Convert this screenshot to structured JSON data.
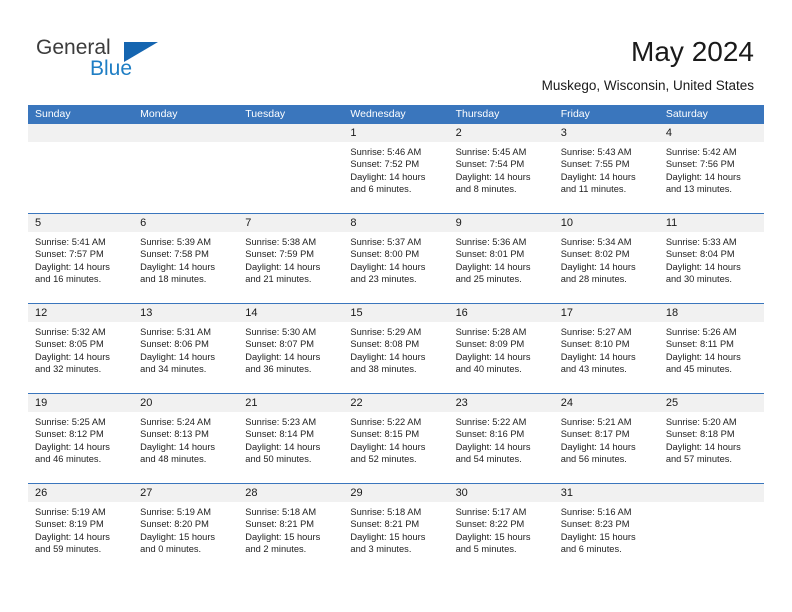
{
  "brand": {
    "name_part1": "General",
    "name_part2": "Blue",
    "triangle_icon": "triangle-icon",
    "accent_color": "#1565b0",
    "blue_text_color": "#1f7ec4"
  },
  "header": {
    "title": "May 2024",
    "location": "Muskego, Wisconsin, United States"
  },
  "calendar": {
    "header_bg": "#3a76bd",
    "day_band_bg": "#f1f1f1",
    "weekdays": [
      "Sunday",
      "Monday",
      "Tuesday",
      "Wednesday",
      "Thursday",
      "Friday",
      "Saturday"
    ],
    "labels": {
      "sunrise": "Sunrise:",
      "sunset": "Sunset:",
      "daylight": "Daylight:"
    },
    "weeks": [
      [
        {
          "day": "",
          "empty": true
        },
        {
          "day": "",
          "empty": true
        },
        {
          "day": "",
          "empty": true
        },
        {
          "day": "1",
          "sunrise": "Sunrise: 5:46 AM",
          "sunset": "Sunset: 7:52 PM",
          "daylight": "Daylight: 14 hours and 6 minutes."
        },
        {
          "day": "2",
          "sunrise": "Sunrise: 5:45 AM",
          "sunset": "Sunset: 7:54 PM",
          "daylight": "Daylight: 14 hours and 8 minutes."
        },
        {
          "day": "3",
          "sunrise": "Sunrise: 5:43 AM",
          "sunset": "Sunset: 7:55 PM",
          "daylight": "Daylight: 14 hours and 11 minutes."
        },
        {
          "day": "4",
          "sunrise": "Sunrise: 5:42 AM",
          "sunset": "Sunset: 7:56 PM",
          "daylight": "Daylight: 14 hours and 13 minutes."
        }
      ],
      [
        {
          "day": "5",
          "sunrise": "Sunrise: 5:41 AM",
          "sunset": "Sunset: 7:57 PM",
          "daylight": "Daylight: 14 hours and 16 minutes."
        },
        {
          "day": "6",
          "sunrise": "Sunrise: 5:39 AM",
          "sunset": "Sunset: 7:58 PM",
          "daylight": "Daylight: 14 hours and 18 minutes."
        },
        {
          "day": "7",
          "sunrise": "Sunrise: 5:38 AM",
          "sunset": "Sunset: 7:59 PM",
          "daylight": "Daylight: 14 hours and 21 minutes."
        },
        {
          "day": "8",
          "sunrise": "Sunrise: 5:37 AM",
          "sunset": "Sunset: 8:00 PM",
          "daylight": "Daylight: 14 hours and 23 minutes."
        },
        {
          "day": "9",
          "sunrise": "Sunrise: 5:36 AM",
          "sunset": "Sunset: 8:01 PM",
          "daylight": "Daylight: 14 hours and 25 minutes."
        },
        {
          "day": "10",
          "sunrise": "Sunrise: 5:34 AM",
          "sunset": "Sunset: 8:02 PM",
          "daylight": "Daylight: 14 hours and 28 minutes."
        },
        {
          "day": "11",
          "sunrise": "Sunrise: 5:33 AM",
          "sunset": "Sunset: 8:04 PM",
          "daylight": "Daylight: 14 hours and 30 minutes."
        }
      ],
      [
        {
          "day": "12",
          "sunrise": "Sunrise: 5:32 AM",
          "sunset": "Sunset: 8:05 PM",
          "daylight": "Daylight: 14 hours and 32 minutes."
        },
        {
          "day": "13",
          "sunrise": "Sunrise: 5:31 AM",
          "sunset": "Sunset: 8:06 PM",
          "daylight": "Daylight: 14 hours and 34 minutes."
        },
        {
          "day": "14",
          "sunrise": "Sunrise: 5:30 AM",
          "sunset": "Sunset: 8:07 PM",
          "daylight": "Daylight: 14 hours and 36 minutes."
        },
        {
          "day": "15",
          "sunrise": "Sunrise: 5:29 AM",
          "sunset": "Sunset: 8:08 PM",
          "daylight": "Daylight: 14 hours and 38 minutes."
        },
        {
          "day": "16",
          "sunrise": "Sunrise: 5:28 AM",
          "sunset": "Sunset: 8:09 PM",
          "daylight": "Daylight: 14 hours and 40 minutes."
        },
        {
          "day": "17",
          "sunrise": "Sunrise: 5:27 AM",
          "sunset": "Sunset: 8:10 PM",
          "daylight": "Daylight: 14 hours and 43 minutes."
        },
        {
          "day": "18",
          "sunrise": "Sunrise: 5:26 AM",
          "sunset": "Sunset: 8:11 PM",
          "daylight": "Daylight: 14 hours and 45 minutes."
        }
      ],
      [
        {
          "day": "19",
          "sunrise": "Sunrise: 5:25 AM",
          "sunset": "Sunset: 8:12 PM",
          "daylight": "Daylight: 14 hours and 46 minutes."
        },
        {
          "day": "20",
          "sunrise": "Sunrise: 5:24 AM",
          "sunset": "Sunset: 8:13 PM",
          "daylight": "Daylight: 14 hours and 48 minutes."
        },
        {
          "day": "21",
          "sunrise": "Sunrise: 5:23 AM",
          "sunset": "Sunset: 8:14 PM",
          "daylight": "Daylight: 14 hours and 50 minutes."
        },
        {
          "day": "22",
          "sunrise": "Sunrise: 5:22 AM",
          "sunset": "Sunset: 8:15 PM",
          "daylight": "Daylight: 14 hours and 52 minutes."
        },
        {
          "day": "23",
          "sunrise": "Sunrise: 5:22 AM",
          "sunset": "Sunset: 8:16 PM",
          "daylight": "Daylight: 14 hours and 54 minutes."
        },
        {
          "day": "24",
          "sunrise": "Sunrise: 5:21 AM",
          "sunset": "Sunset: 8:17 PM",
          "daylight": "Daylight: 14 hours and 56 minutes."
        },
        {
          "day": "25",
          "sunrise": "Sunrise: 5:20 AM",
          "sunset": "Sunset: 8:18 PM",
          "daylight": "Daylight: 14 hours and 57 minutes."
        }
      ],
      [
        {
          "day": "26",
          "sunrise": "Sunrise: 5:19 AM",
          "sunset": "Sunset: 8:19 PM",
          "daylight": "Daylight: 14 hours and 59 minutes."
        },
        {
          "day": "27",
          "sunrise": "Sunrise: 5:19 AM",
          "sunset": "Sunset: 8:20 PM",
          "daylight": "Daylight: 15 hours and 0 minutes."
        },
        {
          "day": "28",
          "sunrise": "Sunrise: 5:18 AM",
          "sunset": "Sunset: 8:21 PM",
          "daylight": "Daylight: 15 hours and 2 minutes."
        },
        {
          "day": "29",
          "sunrise": "Sunrise: 5:18 AM",
          "sunset": "Sunset: 8:21 PM",
          "daylight": "Daylight: 15 hours and 3 minutes."
        },
        {
          "day": "30",
          "sunrise": "Sunrise: 5:17 AM",
          "sunset": "Sunset: 8:22 PM",
          "daylight": "Daylight: 15 hours and 5 minutes."
        },
        {
          "day": "31",
          "sunrise": "Sunrise: 5:16 AM",
          "sunset": "Sunset: 8:23 PM",
          "daylight": "Daylight: 15 hours and 6 minutes."
        },
        {
          "day": "",
          "empty": true
        }
      ]
    ]
  }
}
